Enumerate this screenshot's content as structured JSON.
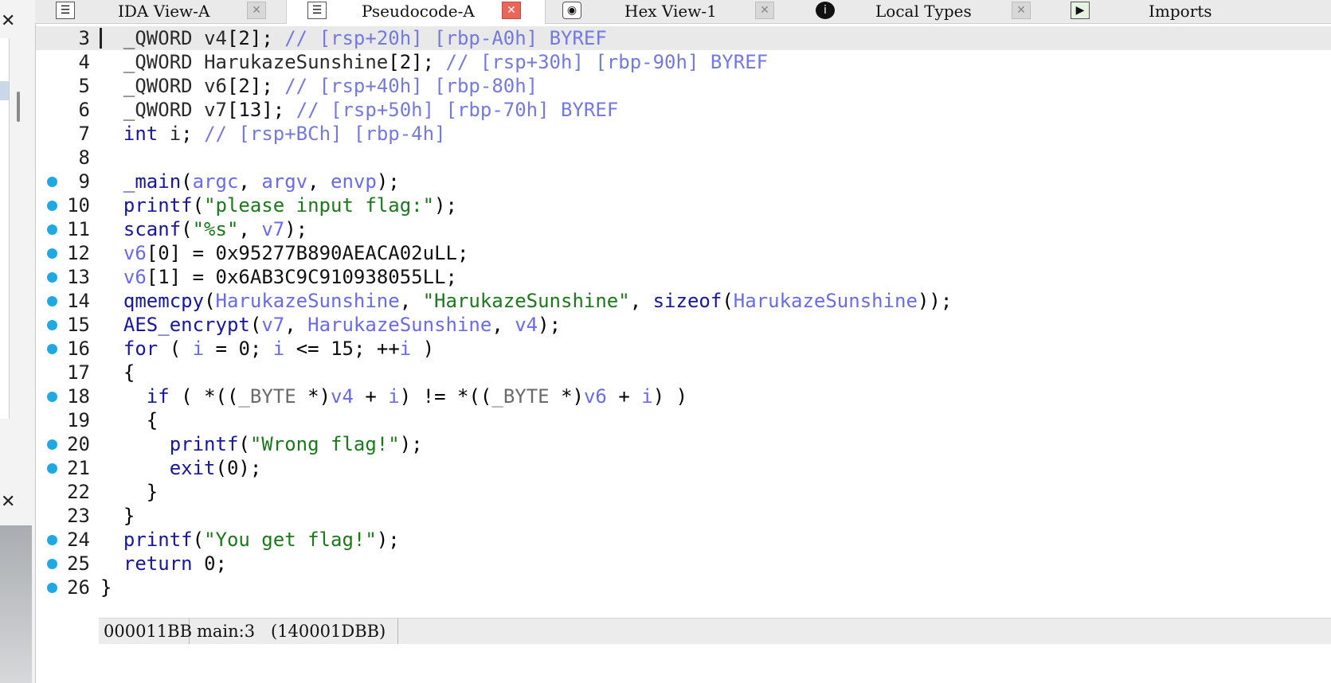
{
  "tabs": [
    {
      "label": "IDA View-A",
      "icon": "listing-icon",
      "active": false
    },
    {
      "label": "Pseudocode-A",
      "icon": "listing-icon",
      "active": true
    },
    {
      "label": "Hex View-1",
      "icon": "hex-icon",
      "active": false
    },
    {
      "label": "Local Types",
      "icon": "info-icon",
      "active": false
    },
    {
      "label": "Imports",
      "icon": "imports-icon",
      "active": false
    }
  ],
  "code": {
    "lines": [
      {
        "num": "3",
        "text": "  _QWORD v4[2]; // [rsp+20h] [rbp-A0h] BYREF"
      },
      {
        "num": "4",
        "text": "  _QWORD HarukazeSunshine[2]; // [rsp+30h] [rbp-90h] BYREF"
      },
      {
        "num": "5",
        "text": "  _QWORD v6[2]; // [rsp+40h] [rbp-80h]"
      },
      {
        "num": "6",
        "text": "  _QWORD v7[13]; // [rsp+50h] [rbp-70h] BYREF"
      },
      {
        "num": "7",
        "text": "  int i; // [rsp+BCh] [rbp-4h]"
      },
      {
        "num": "8",
        "text": ""
      },
      {
        "num": "9",
        "text": "  _main(argc, argv, envp);"
      },
      {
        "num": "10",
        "text": "  printf(\"please input flag:\");"
      },
      {
        "num": "11",
        "text": "  scanf(\"%s\", v7);"
      },
      {
        "num": "12",
        "text": "  v6[0] = 0x95277B890AEACA02uLL;"
      },
      {
        "num": "13",
        "text": "  v6[1] = 0x6AB3C9C910938055LL;"
      },
      {
        "num": "14",
        "text": "  qmemcpy(HarukazeSunshine, \"HarukazeSunshine\", sizeof(HarukazeSunshine));"
      },
      {
        "num": "15",
        "text": "  AES_encrypt(v7, HarukazeSunshine, v4);"
      },
      {
        "num": "16",
        "text": "  for ( i = 0; i <= 15; ++i )"
      },
      {
        "num": "17",
        "text": "  {"
      },
      {
        "num": "18",
        "text": "    if ( *((_BYTE *)v4 + i) != *((_BYTE *)v6 + i) )"
      },
      {
        "num": "19",
        "text": "    {"
      },
      {
        "num": "20",
        "text": "      printf(\"Wrong flag!\");"
      },
      {
        "num": "21",
        "text": "      exit(0);"
      },
      {
        "num": "22",
        "text": "    }"
      },
      {
        "num": "23",
        "text": "  }"
      },
      {
        "num": "24",
        "text": "  printf(\"You get flag!\");"
      },
      {
        "num": "25",
        "text": "  return 0;"
      },
      {
        "num": "26",
        "text": "}"
      }
    ]
  },
  "status": {
    "address": "000011BB",
    "location": "main:3",
    "ea": "(140001DBB)"
  },
  "colors": {
    "breakpoint_dot": "#1fa9e4",
    "comment": "#7479e0",
    "variable": "#6a6aec",
    "function": "#1616a0",
    "string": "#1a7a1a",
    "active_tab_close": "#e8665a"
  }
}
